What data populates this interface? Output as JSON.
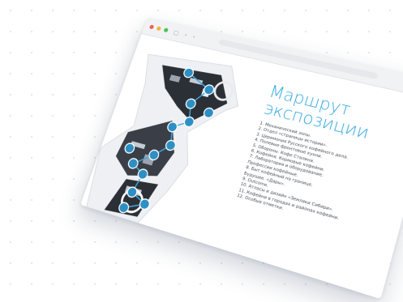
{
  "window": {
    "controls": [
      "close",
      "minimize",
      "maximize"
    ],
    "nav_icons": [
      "sidebar-icon",
      "back-icon",
      "forward-icon"
    ],
    "right_icons": [
      "plus-icon",
      "copy-icon"
    ],
    "toolbar_glyphs": {
      "sidebar": "▢",
      "back": "‹",
      "forward": "›",
      "add": "+",
      "copy": "⧉"
    }
  },
  "page": {
    "title_line1": "Маршрут",
    "title_line2": "экспозиции",
    "route": [
      "1. Механический зоны.",
      "2. Отдел «страницы истории».",
      "3. Церемония Русского кофейного дела.",
      "4. Полевые фронтовые кухни.",
      "5. Обороны. Кофе Сталина.",
      "6. Кофейня. Кормовые кофейни.",
      "7. Лаборатория и оборудование.",
      "   Профессии кофейные.",
      "8. Быт кофейный на границе.",
      "   Будущее. «Дары».",
      "9. Outcome.",
      "10. Атласы и дизайн «Земляки Сибири».",
      "11. Кофейни в городах и районах кофейни.",
      "12. Особые отметки."
    ]
  },
  "colors": {
    "accent": "#36a9e1",
    "marker": "#2d8fc4",
    "route_line": "#3fa9e0",
    "floor_dark": "#2b2f36"
  },
  "plan_markers": [
    "1",
    "2",
    "3",
    "4",
    "5",
    "6",
    "7",
    "8",
    "9",
    "10",
    "11",
    "12",
    "13",
    "14"
  ]
}
